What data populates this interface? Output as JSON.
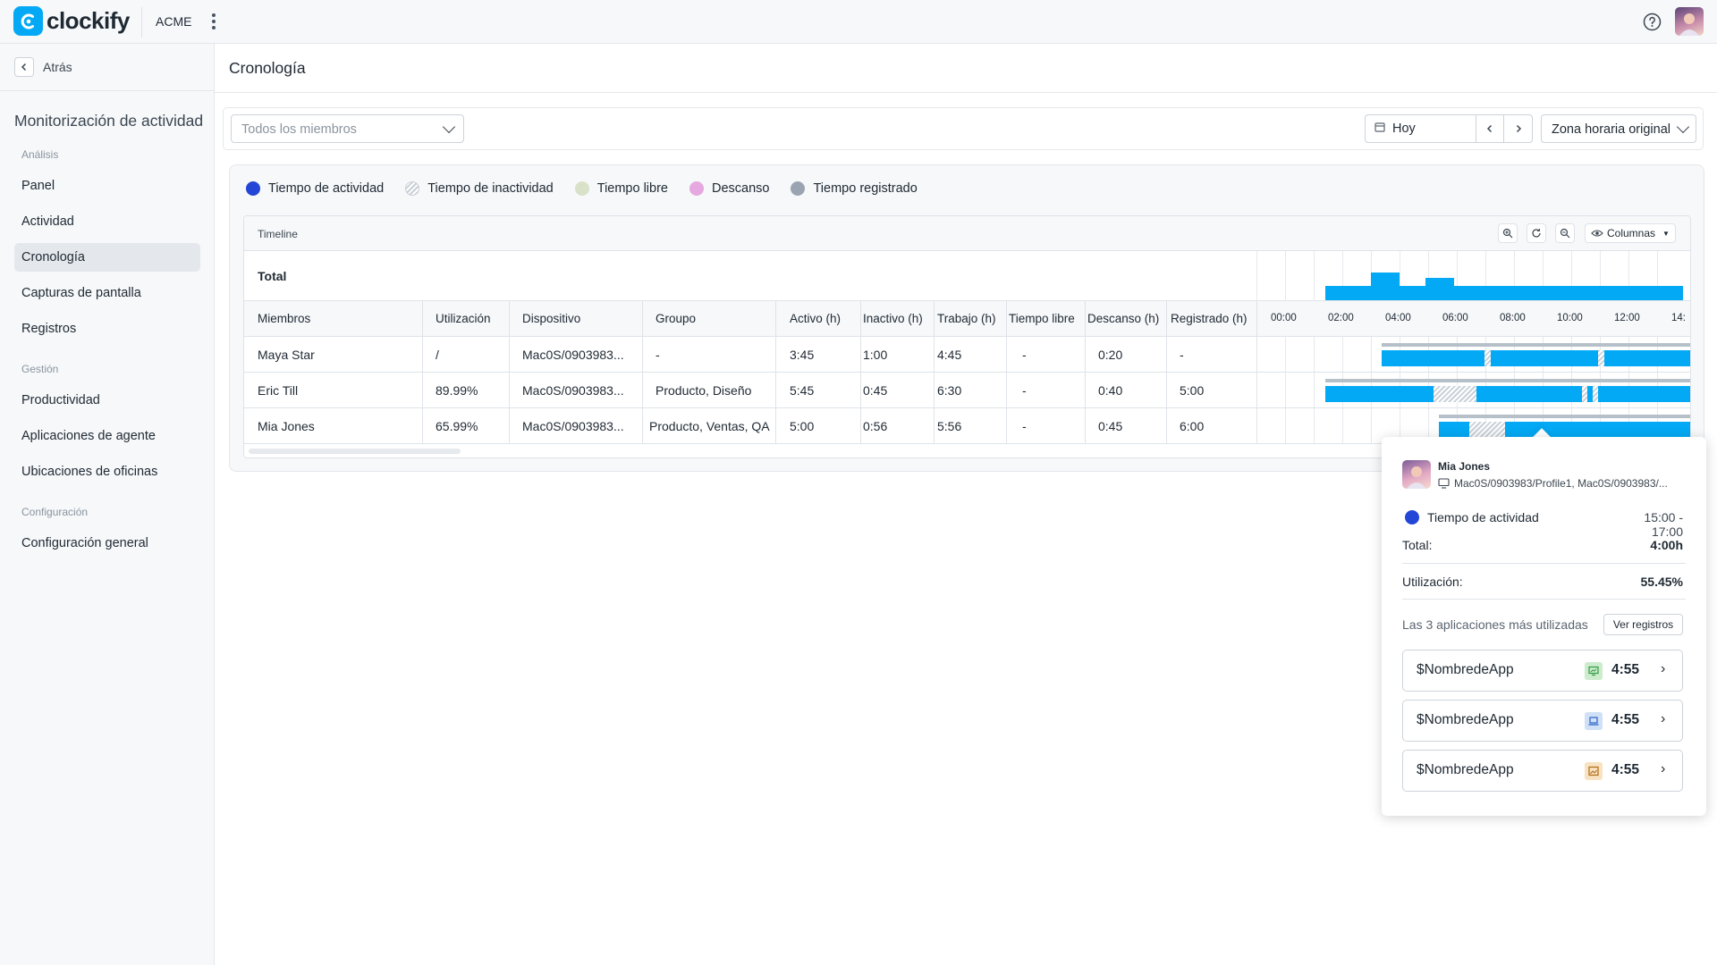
{
  "app": {
    "brand": "clockify",
    "workspace": "ACME"
  },
  "colors": {
    "brand": "#03a9f4",
    "activity": "#2446d6",
    "free": "#d9e2c8",
    "break": "#e5a8e0",
    "registered": "#9aa5b1"
  },
  "sidebar": {
    "back_label": "Atrás",
    "title": "Monitorización de actividad",
    "groups": [
      {
        "label": "Análisis",
        "items": [
          "Panel",
          "Actividad",
          "Cronología",
          "Capturas de pantalla",
          "Registros"
        ]
      },
      {
        "label": "Gestión",
        "items": [
          "Productividad",
          "Aplicaciones de agente",
          "Ubicaciones de oficinas"
        ]
      },
      {
        "label": "Configuración",
        "items": [
          "Configuración general"
        ]
      }
    ],
    "active_item": "Cronología"
  },
  "page": {
    "title": "Cronología"
  },
  "filters": {
    "members_placeholder": "Todos los miembros",
    "date_label": "Hoy",
    "prev_icon": "chevron-left-icon",
    "next_icon": "chevron-right-icon",
    "timezone_label": "Zona horaria original"
  },
  "legend": [
    "Tiempo de actividad",
    "Tiempo de inactividad",
    "Tiempo libre",
    "Descanso",
    "Tiempo registrado"
  ],
  "timeline": {
    "title": "Timeline",
    "columns_label": "Columnas",
    "total_label": "Total",
    "headers": [
      "Miembros",
      "Utilización",
      "Dispositivo",
      "Groupo",
      "Activo (h)",
      "Inactivo (h)",
      "Trabajo (h)",
      "Tiempo libre",
      "Descanso (h)",
      "Registrado (h)"
    ],
    "ticks": [
      "00:00",
      "02:00",
      "04:00",
      "06:00",
      "08:00",
      "10:00",
      "12:00",
      "14:"
    ],
    "rows": [
      {
        "cells": [
          "Maya Star",
          "/",
          "Mac0S/0903983...",
          "-",
          "3:45",
          "1:00",
          "4:45",
          "-",
          "0:20",
          "-"
        ]
      },
      {
        "cells": [
          "Eric Till",
          "89.99%",
          "Mac0S/0903983...",
          "Producto, Diseño",
          "5:45",
          "0:45",
          "6:30",
          "-",
          "0:40",
          "5:00"
        ]
      },
      {
        "cells": [
          "Mia Jones",
          "65.99%",
          "Mac0S/0903983...",
          "Producto, Ventas, QA",
          "5:00",
          "0:56",
          "5:56",
          "-",
          "0:45",
          "6:00"
        ]
      }
    ]
  },
  "popover": {
    "name": "Mia Jones",
    "device": "Mac0S/0903983/Profile1, Mac0S/0903983/...",
    "activity_label": "Tiempo de actividad",
    "activity_range": "15:00 - 17:00",
    "total_label": "Total:",
    "total_value": "4:00h",
    "util_label": "Utilización:",
    "util_value": "55.45%",
    "top_apps_label": "Las 3 aplicaciones más utilizadas",
    "view_logs_label": "Ver registros",
    "apps": [
      {
        "name": "$NombredeApp",
        "time": "4:55",
        "icon": "monitor-chart-icon",
        "icon_bg": "#cdeccd",
        "icon_color": "#2f9a44"
      },
      {
        "name": "$NombredeApp",
        "time": "4:55",
        "icon": "laptop-icon",
        "icon_bg": "#cfe0f7",
        "icon_color": "#2e62c9"
      },
      {
        "name": "$NombredeApp",
        "time": "4:55",
        "icon": "image-icon",
        "icon_bg": "#f8e2c2",
        "icon_color": "#b06a12"
      }
    ]
  }
}
